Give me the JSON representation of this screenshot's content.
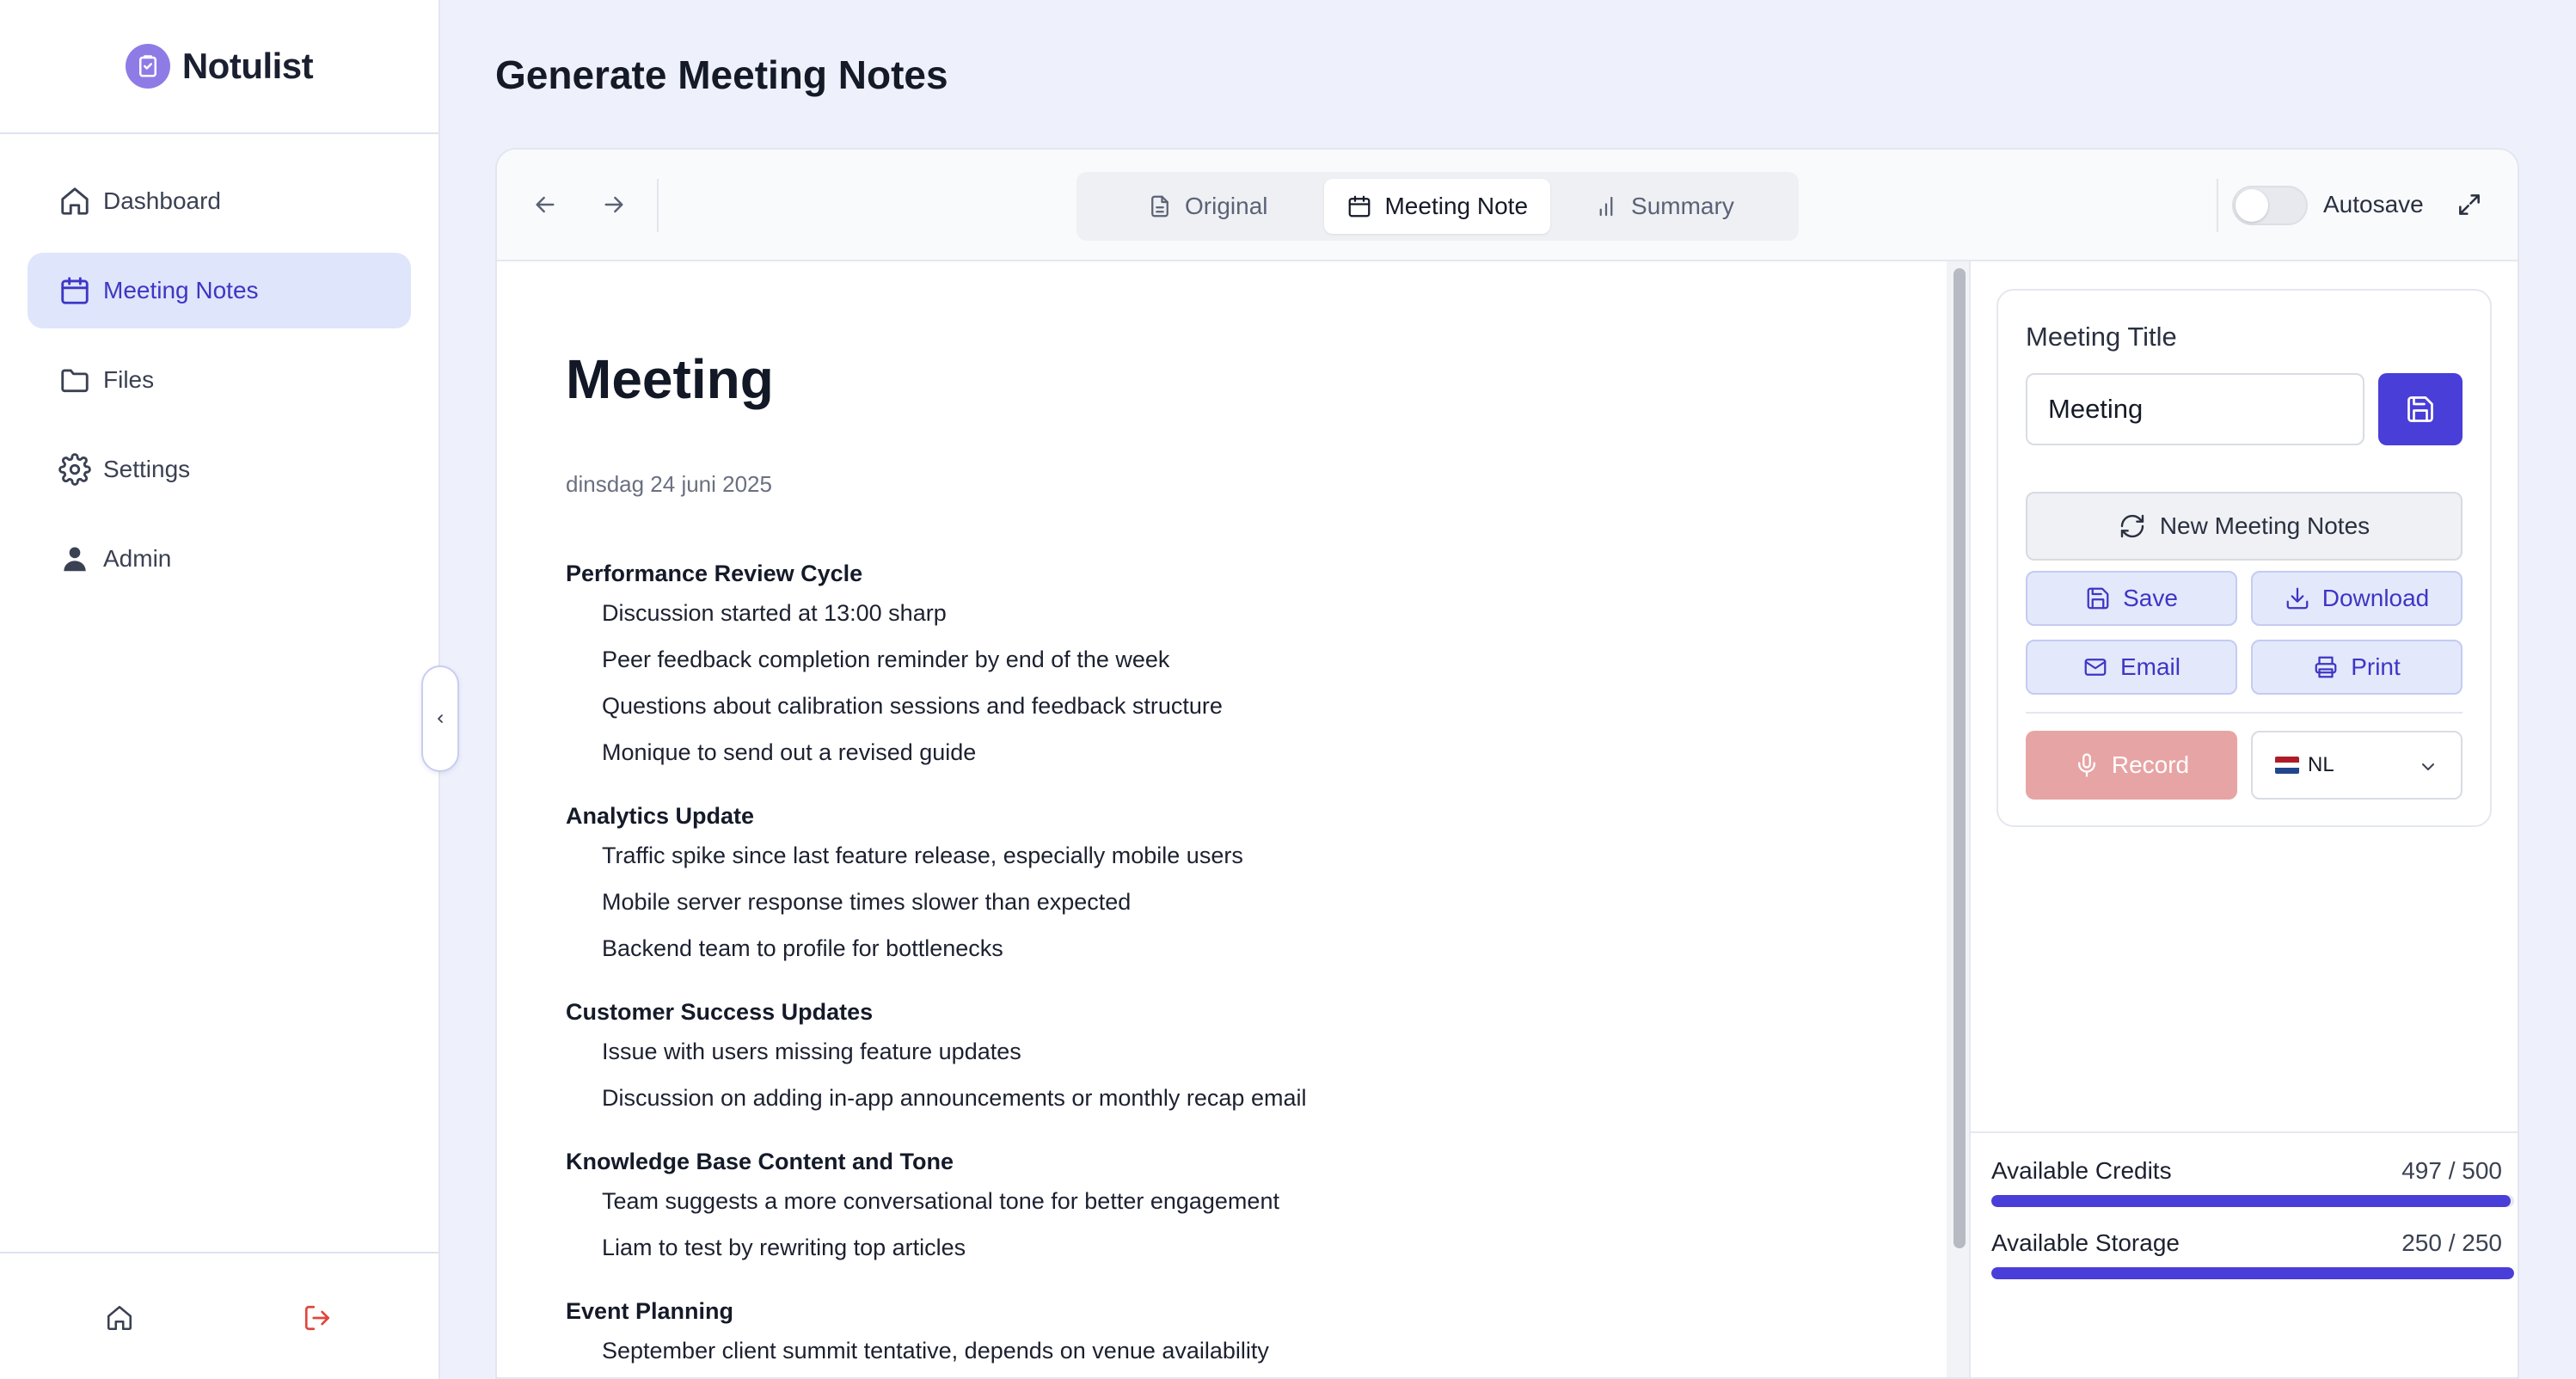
{
  "app": {
    "name": "Notulist"
  },
  "sidebar": {
    "items": [
      {
        "label": "Dashboard",
        "icon": "home-icon"
      },
      {
        "label": "Meeting Notes",
        "icon": "calendar-icon"
      },
      {
        "label": "Files",
        "icon": "folder-icon"
      },
      {
        "label": "Settings",
        "icon": "gear-icon"
      },
      {
        "label": "Admin",
        "icon": "user-icon"
      }
    ],
    "active_index": 1,
    "footer_icons": [
      "home-icon",
      "logout-icon"
    ]
  },
  "page": {
    "title": "Generate Meeting Notes"
  },
  "toolbar": {
    "tabs": [
      {
        "label": "Original",
        "icon": "document-icon"
      },
      {
        "label": "Meeting Note",
        "icon": "calendar-icon"
      },
      {
        "label": "Summary",
        "icon": "bar-chart-icon"
      }
    ],
    "active_tab": 1,
    "autosave_label": "Autosave",
    "autosave_on": false
  },
  "document": {
    "title": "Meeting",
    "date": "dinsdag 24 juni 2025",
    "sections": [
      {
        "heading": "Performance Review Cycle",
        "items": [
          "Discussion started at 13:00 sharp",
          "Peer feedback completion reminder by end of the week",
          "Questions about calibration sessions and feedback structure",
          "Monique to send out a revised guide"
        ]
      },
      {
        "heading": "Analytics Update",
        "items": [
          "Traffic spike since last feature release, especially mobile users",
          "Mobile server response times slower than expected",
          "Backend team to profile for bottlenecks"
        ]
      },
      {
        "heading": "Customer Success Updates",
        "items": [
          "Issue with users missing feature updates",
          "Discussion on adding in-app announcements or monthly recap email"
        ]
      },
      {
        "heading": "Knowledge Base Content and Tone",
        "items": [
          "Team suggests a more conversational tone for better engagement",
          "Liam to test by rewriting top articles"
        ]
      },
      {
        "heading": "Event Planning",
        "items": [
          "September client summit tentative, depends on venue availability"
        ]
      }
    ]
  },
  "panel": {
    "title_label": "Meeting Title",
    "title_value": "Meeting",
    "new_notes_label": "New Meeting Notes",
    "save_label": "Save",
    "download_label": "Download",
    "email_label": "Email",
    "print_label": "Print",
    "record_label": "Record",
    "language": "NL",
    "colors": {
      "primary": "#4a3ed8",
      "record": "#e7a4a4",
      "light_button": "#e4e8fb"
    }
  },
  "usage": {
    "credits_label": "Available Credits",
    "credits_value": "497 / 500",
    "credits_fraction": 0.994,
    "storage_label": "Available Storage",
    "storage_value": "250 / 250",
    "storage_fraction": 1.0
  }
}
